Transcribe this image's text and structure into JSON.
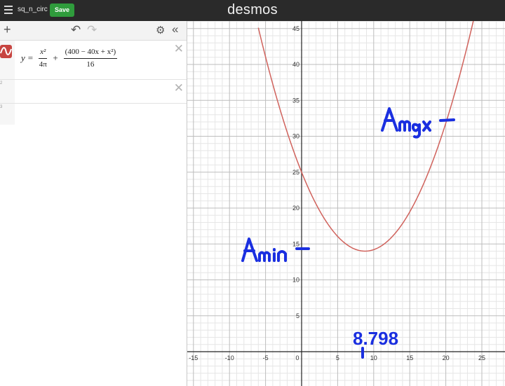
{
  "app": {
    "doc_title": "sq_n_circ",
    "save_label": "Save",
    "brand": "desmos",
    "menu_icon": "hamburger-icon"
  },
  "toolbar": {
    "add_icon": "plus-icon",
    "undo_icon": "undo-icon",
    "redo_icon": "redo-icon",
    "settings_icon": "gear-icon",
    "collapse_icon": "double-chevron-left-icon"
  },
  "expressions": [
    {
      "index": "1",
      "lhs": "y",
      "eq": "=",
      "term1_num": "x²",
      "term1_den": "4π",
      "plus": "+",
      "term2_num": "(400 − 40x + x²)",
      "term2_den": "16",
      "color": "#c74440"
    },
    {
      "index": "2"
    },
    {
      "index": "3"
    }
  ],
  "graph": {
    "x_ticks": [
      "-15",
      "-10",
      "-5",
      "0",
      "5",
      "10",
      "15",
      "20",
      "25"
    ],
    "y_ticks": [
      "5",
      "10",
      "15",
      "20",
      "25",
      "30",
      "35",
      "40",
      "45"
    ],
    "curve_color": "#d0625c",
    "annotation_color": "#1a2fe0",
    "annotations": {
      "amax": "Amax",
      "amin": "Amin",
      "xmin_value": "8.798"
    }
  }
}
